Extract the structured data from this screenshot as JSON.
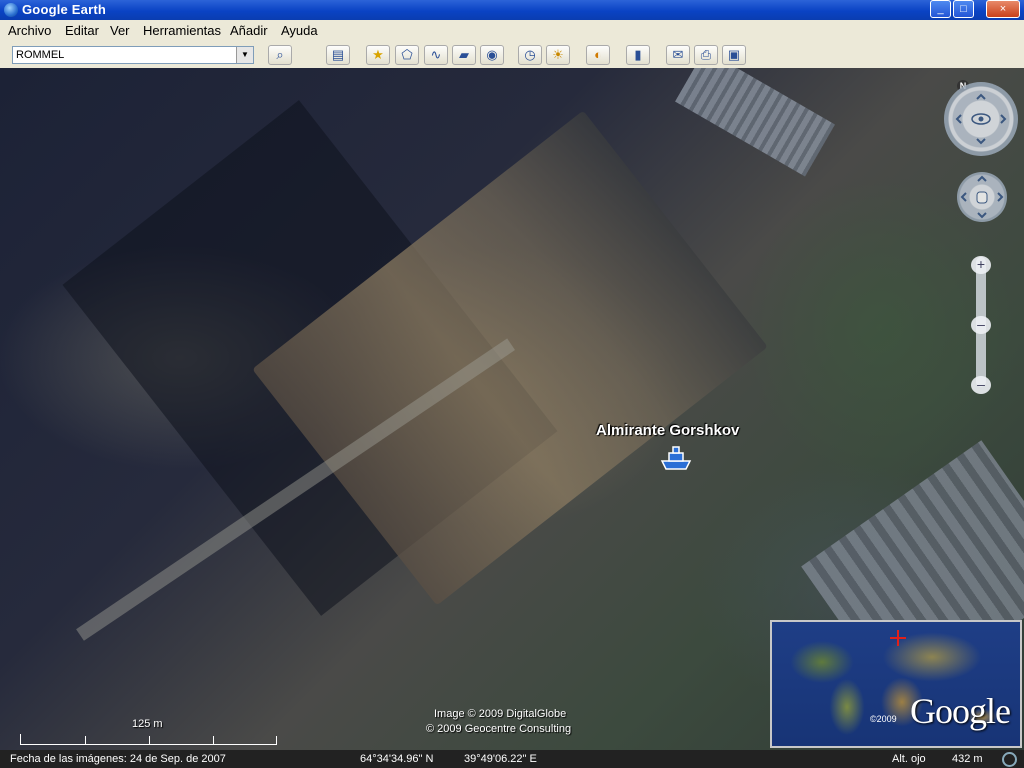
{
  "window": {
    "title": "Google Earth",
    "minimize": "_",
    "maximize": "□",
    "close": "×"
  },
  "menu": [
    "Archivo",
    "Editar",
    "Ver",
    "Herramientas",
    "Añadir",
    "Ayuda"
  ],
  "search": {
    "value": "ROMMEL"
  },
  "toolbar_icons": [
    "search-icon",
    "sidebar-toggle-icon",
    "placemark-add-icon",
    "polygon-add-icon",
    "path-add-icon",
    "overlay-add-icon",
    "record-tour-icon",
    "historical-imagery-icon",
    "sunlight-icon",
    "planets-icon",
    "ruler-icon",
    "email-icon",
    "print-icon",
    "save-image-icon"
  ],
  "map": {
    "placemark_label": "Almirante Gorshkov",
    "copyright_1": "Image © 2009 DigitalGlobe",
    "copyright_2": "© 2009 Geocentre Consulting",
    "scale_label": "125 m",
    "overview_brand": "Google",
    "overview_year": "©2009",
    "north": "N"
  },
  "status": {
    "imagery_date": "Fecha de las imágenes: 24 de Sep. de 2007",
    "lat": "64°34'34.96\" N",
    "lon": "39°49'06.22\" E",
    "alt_label": "Alt. ojo",
    "alt_value": "432 m"
  }
}
